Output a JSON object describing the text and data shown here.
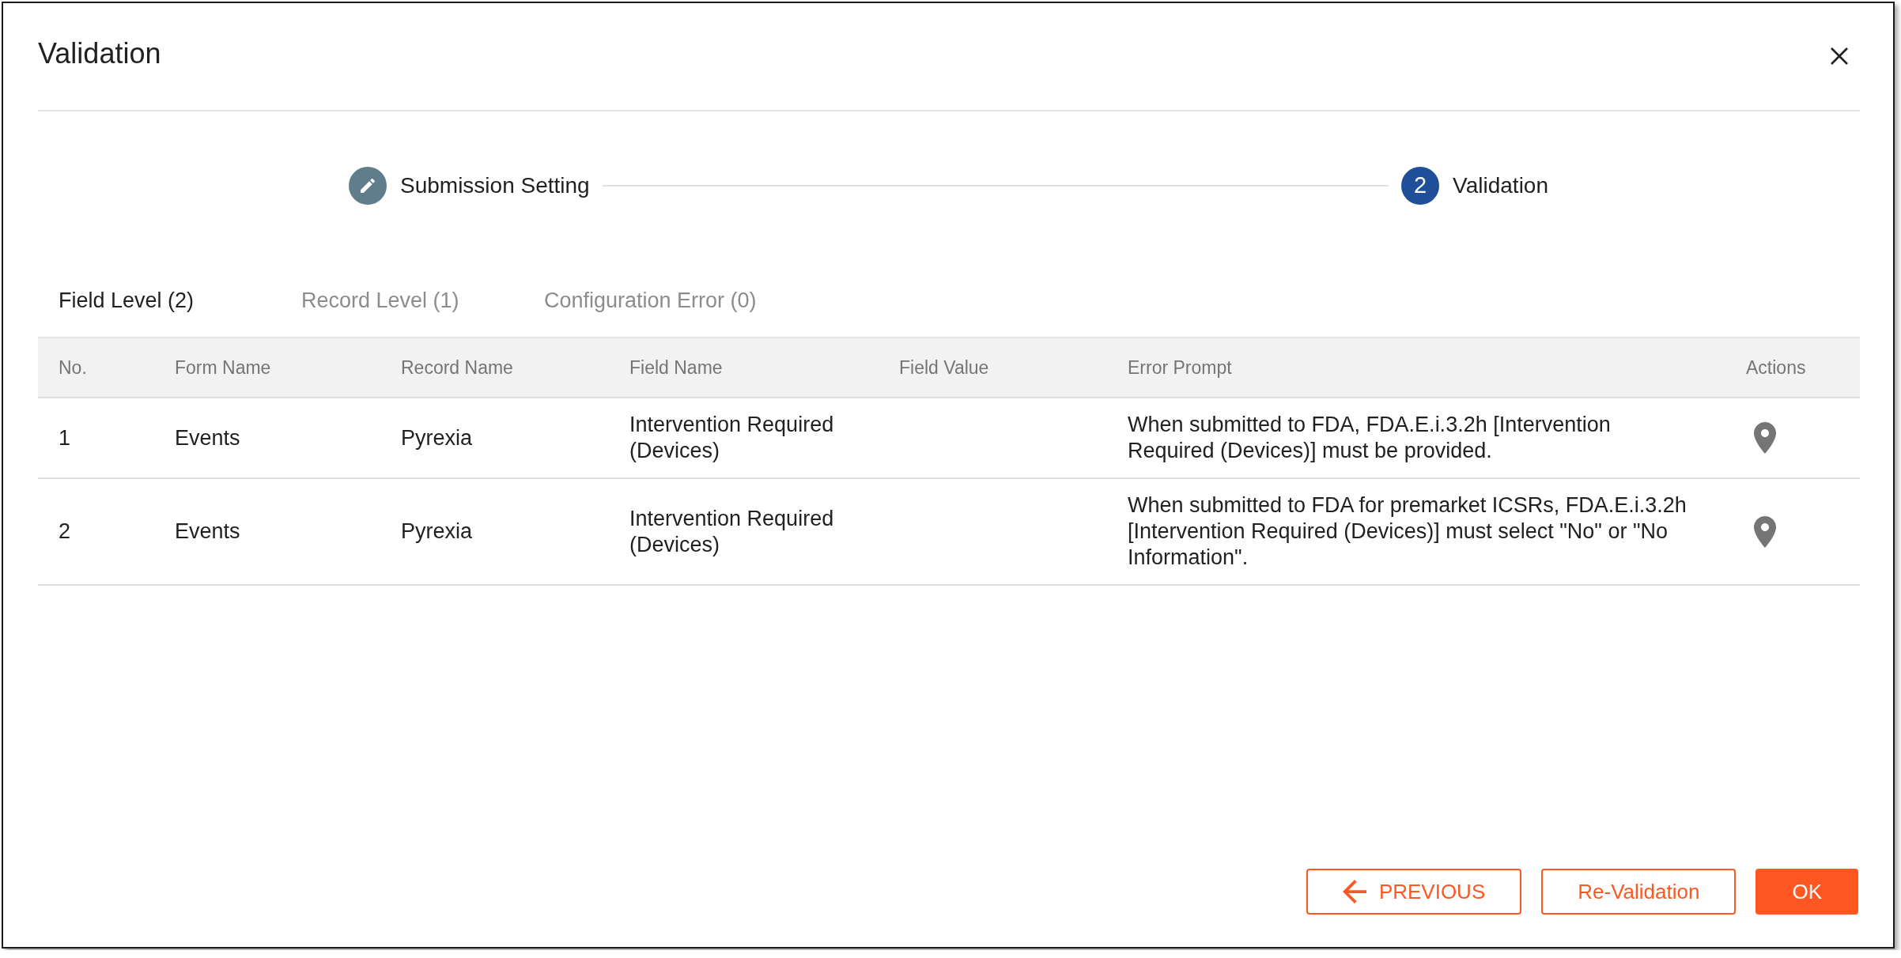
{
  "dialog": {
    "title": "Validation"
  },
  "stepper": {
    "steps": [
      {
        "label": "Submission Setting",
        "completed": true
      },
      {
        "label": "Validation",
        "number": "2",
        "completed": false
      }
    ]
  },
  "tabs": [
    {
      "label": "Field Level (2)",
      "selected": true
    },
    {
      "label": "Record Level (1)",
      "selected": false
    },
    {
      "label": "Configuration Error (0)",
      "selected": false
    }
  ],
  "table": {
    "columns": [
      "No.",
      "Form Name",
      "Record Name",
      "Field Name",
      "Field Value",
      "Error Prompt",
      "Actions"
    ],
    "rows": [
      {
        "no": "1",
        "form_name": "Events",
        "record_name": "Pyrexia",
        "field_name": "Intervention Required (Devices)",
        "error_prompt": "When submitted to FDA, FDA.E.i.3.2h [Intervention Required (Devices)] must be provided."
      },
      {
        "no": "2",
        "form_name": "Events",
        "record_name": "Pyrexia",
        "field_name": "Intervention Required (Devices)",
        "error_prompt": "When submitted to FDA for premarket ICSRs, FDA.E.i.3.2h [Intervention Required (Devices)] must select \"No\" or \"No Information\"."
      }
    ]
  },
  "buttons": [
    {
      "label": "PREVIOUS",
      "kind": "back"
    },
    {
      "label": "Re-Validation",
      "kind": "outline"
    },
    {
      "label": "OK",
      "kind": "primary"
    }
  ]
}
